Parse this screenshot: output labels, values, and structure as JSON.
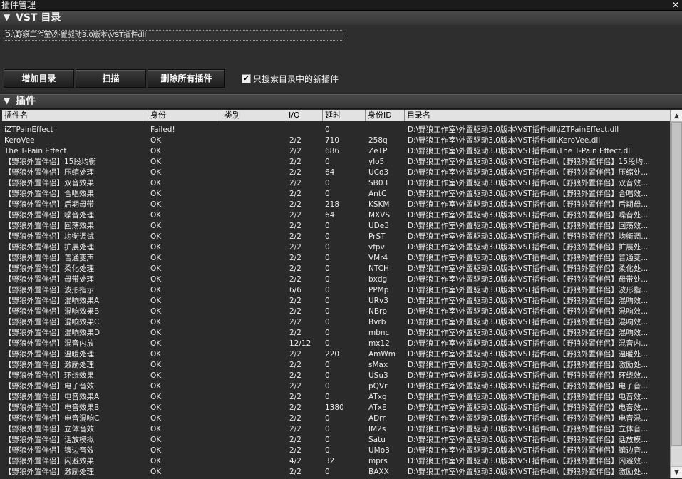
{
  "window": {
    "title": "插件管理",
    "close_glyph": "✕"
  },
  "vst_section": {
    "label": "VST 目录",
    "arrow": "▼"
  },
  "vst_path": "D:\\野狼工作室\\外置驱动3.0版本\\VST插件dll",
  "buttons": {
    "add": "增加目录",
    "scan": "扫描",
    "delete_all": "删除所有插件"
  },
  "search_new_only": {
    "label": "只搜索目录中的新插件",
    "checked": true
  },
  "plugins_section": {
    "label": "插件",
    "arrow": "▼"
  },
  "table": {
    "columns": [
      "插件名",
      "身份",
      "类别",
      "I/O",
      "延时",
      "身份ID",
      "目录名"
    ],
    "rows": [
      [
        "iZTPainEffect",
        "Failed!",
        "",
        "",
        "0",
        "",
        "D:\\野狼工作室\\外置驱动3.0版本\\VST插件dll\\iZTPainEffect.dll"
      ],
      [
        "KeroVee",
        "OK",
        "",
        "2/2",
        "710",
        "258q",
        "D:\\野狼工作室\\外置驱动3.0版本\\VST插件dll\\KeroVee.dll"
      ],
      [
        "The T-Pain Effect",
        "OK",
        "",
        "2/2",
        "686",
        "ZeTP",
        "D:\\野狼工作室\\外置驱动3.0版本\\VST插件dll\\The T-Pain Effect.dll"
      ],
      [
        "【野狼外置伴侣】15段均衡",
        "OK",
        "",
        "2/2",
        "0",
        "ylo5",
        "D:\\野狼工作室\\外置驱动3.0版本\\VST插件dll\\【野狼外置伴侣】15段均..."
      ],
      [
        "【野狼外置伴侣】压缩处理",
        "OK",
        "",
        "2/2",
        "64",
        "UCo3",
        "D:\\野狼工作室\\外置驱动3.0版本\\VST插件dll\\【野狼外置伴侣】压缩处..."
      ],
      [
        "【野狼外置伴侣】双音效果",
        "OK",
        "",
        "2/2",
        "0",
        "SB03",
        "D:\\野狼工作室\\外置驱动3.0版本\\VST插件dll\\【野狼外置伴侣】双音效..."
      ],
      [
        "【野狼外置伴侣】合唱效果",
        "OK",
        "",
        "2/2",
        "0",
        "AntC",
        "D:\\野狼工作室\\外置驱动3.0版本\\VST插件dll\\【野狼外置伴侣】合唱效..."
      ],
      [
        "【野狼外置伴侣】后期母带",
        "OK",
        "",
        "2/2",
        "218",
        "KSKM",
        "D:\\野狼工作室\\外置驱动3.0版本\\VST插件dll\\【野狼外置伴侣】后期母..."
      ],
      [
        "【野狼外置伴侣】噪音处理",
        "OK",
        "",
        "2/2",
        "64",
        "MXVS",
        "D:\\野狼工作室\\外置驱动3.0版本\\VST插件dll\\【野狼外置伴侣】噪音处..."
      ],
      [
        "【野狼外置伴侣】回荡效果",
        "OK",
        "",
        "2/2",
        "0",
        "UDe3",
        "D:\\野狼工作室\\外置驱动3.0版本\\VST插件dll\\【野狼外置伴侣】回荡效..."
      ],
      [
        "【野狼外置伴侣】均衡调试",
        "OK",
        "",
        "2/2",
        "0",
        "PrST",
        "D:\\野狼工作室\\外置驱动3.0版本\\VST插件dll\\【野狼外置伴侣】均衡调..."
      ],
      [
        "【野狼外置伴侣】扩展处理",
        "OK",
        "",
        "2/2",
        "0",
        "vfpv",
        "D:\\野狼工作室\\外置驱动3.0版本\\VST插件dll\\【野狼外置伴侣】扩展处..."
      ],
      [
        "【野狼外置伴侣】普通变声",
        "OK",
        "",
        "2/2",
        "0",
        "VMr4",
        "D:\\野狼工作室\\外置驱动3.0版本\\VST插件dll\\【野狼外置伴侣】普通变..."
      ],
      [
        "【野狼外置伴侣】柔化处理",
        "OK",
        "",
        "2/2",
        "0",
        "NTCH",
        "D:\\野狼工作室\\外置驱动3.0版本\\VST插件dll\\【野狼外置伴侣】柔化处..."
      ],
      [
        "【野狼外置伴侣】母带处理",
        "OK",
        "",
        "2/2",
        "0",
        "bxdg",
        "D:\\野狼工作室\\外置驱动3.0版本\\VST插件dll\\【野狼外置伴侣】母带处..."
      ],
      [
        "【野狼外置伴侣】波形指示",
        "OK",
        "",
        "6/6",
        "0",
        "PPMp",
        "D:\\野狼工作室\\外置驱动3.0版本\\VST插件dll\\【野狼外置伴侣】波形指..."
      ],
      [
        "【野狼外置伴侣】混响效果A",
        "OK",
        "",
        "2/2",
        "0",
        "URv3",
        "D:\\野狼工作室\\外置驱动3.0版本\\VST插件dll\\【野狼外置伴侣】混响效..."
      ],
      [
        "【野狼外置伴侣】混响效果B",
        "OK",
        "",
        "2/2",
        "0",
        "NBrp",
        "D:\\野狼工作室\\外置驱动3.0版本\\VST插件dll\\【野狼外置伴侣】混响效..."
      ],
      [
        "【野狼外置伴侣】混响效果C",
        "OK",
        "",
        "2/2",
        "0",
        "Bvrb",
        "D:\\野狼工作室\\外置驱动3.0版本\\VST插件dll\\【野狼外置伴侣】混响效..."
      ],
      [
        "【野狼外置伴侣】混响效果D",
        "OK",
        "",
        "2/2",
        "0",
        "mbnc",
        "D:\\野狼工作室\\外置驱动3.0版本\\VST插件dll\\【野狼外置伴侣】混响效..."
      ],
      [
        "【野狼外置伴侣】混音内放",
        "OK",
        "",
        "12/12",
        "0",
        "mx12",
        "D:\\野狼工作室\\外置驱动3.0版本\\VST插件dll\\【野狼外置伴侣】混音内..."
      ],
      [
        "【野狼外置伴侣】温暖处理",
        "OK",
        "",
        "2/2",
        "220",
        "AmWm",
        "D:\\野狼工作室\\外置驱动3.0版本\\VST插件dll\\【野狼外置伴侣】温暖处..."
      ],
      [
        "【野狼外置伴侣】激励处理",
        "OK",
        "",
        "2/2",
        "0",
        "sMax",
        "D:\\野狼工作室\\外置驱动3.0版本\\VST插件dll\\【野狼外置伴侣】激励处..."
      ],
      [
        "【野狼外置伴侣】环绕效果",
        "OK",
        "",
        "2/2",
        "0",
        "USu3",
        "D:\\野狼工作室\\外置驱动3.0版本\\VST插件dll\\【野狼外置伴侣】环绕效..."
      ],
      [
        "【野狼外置伴侣】电子音效",
        "OK",
        "",
        "2/2",
        "0",
        "pQVr",
        "D:\\野狼工作室\\外置驱动3.0版本\\VST插件dll\\【野狼外置伴侣】电子音..."
      ],
      [
        "【野狼外置伴侣】电音效果A",
        "OK",
        "",
        "2/2",
        "0",
        "ATxq",
        "D:\\野狼工作室\\外置驱动3.0版本\\VST插件dll\\【野狼外置伴侣】电音效..."
      ],
      [
        "【野狼外置伴侣】电音效果B",
        "OK",
        "",
        "2/2",
        "1380",
        "ATxE",
        "D:\\野狼工作室\\外置驱动3.0版本\\VST插件dll\\【野狼外置伴侣】电音效..."
      ],
      [
        "【野狼外置伴侣】电音混响C",
        "OK",
        "",
        "2/2",
        "0",
        "ADrr",
        "D:\\野狼工作室\\外置驱动3.0版本\\VST插件dll\\【野狼外置伴侣】电音混..."
      ],
      [
        "【野狼外置伴侣】立体音效",
        "OK",
        "",
        "2/2",
        "0",
        "IM2s",
        "D:\\野狼工作室\\外置驱动3.0版本\\VST插件dll\\【野狼外置伴侣】立体音..."
      ],
      [
        "【野狼外置伴侣】话放模拟",
        "OK",
        "",
        "2/2",
        "0",
        "Satu",
        "D:\\野狼工作室\\外置驱动3.0版本\\VST插件dll\\【野狼外置伴侣】话放模..."
      ],
      [
        "【野狼外置伴侣】镶边音效",
        "OK",
        "",
        "2/2",
        "0",
        "UMo3",
        "D:\\野狼工作室\\外置驱动3.0版本\\VST插件dll\\【野狼外置伴侣】镶边音..."
      ],
      [
        "【野狼外置伴侣】闪避效果",
        "OK",
        "",
        "4/2",
        "32",
        "mprs",
        "D:\\野狼工作室\\外置驱动3.0版本\\VST插件dll\\【野狼外置伴侣】闪避效..."
      ],
      [
        "【野狼外置伴侣】激励处理",
        "OK",
        "",
        "2/2",
        "0",
        "BAXX",
        "D:\\野狼工作室\\外置驱动3.0版本\\VST插件dll\\【野狼外置伴侣】激励处..."
      ]
    ]
  }
}
